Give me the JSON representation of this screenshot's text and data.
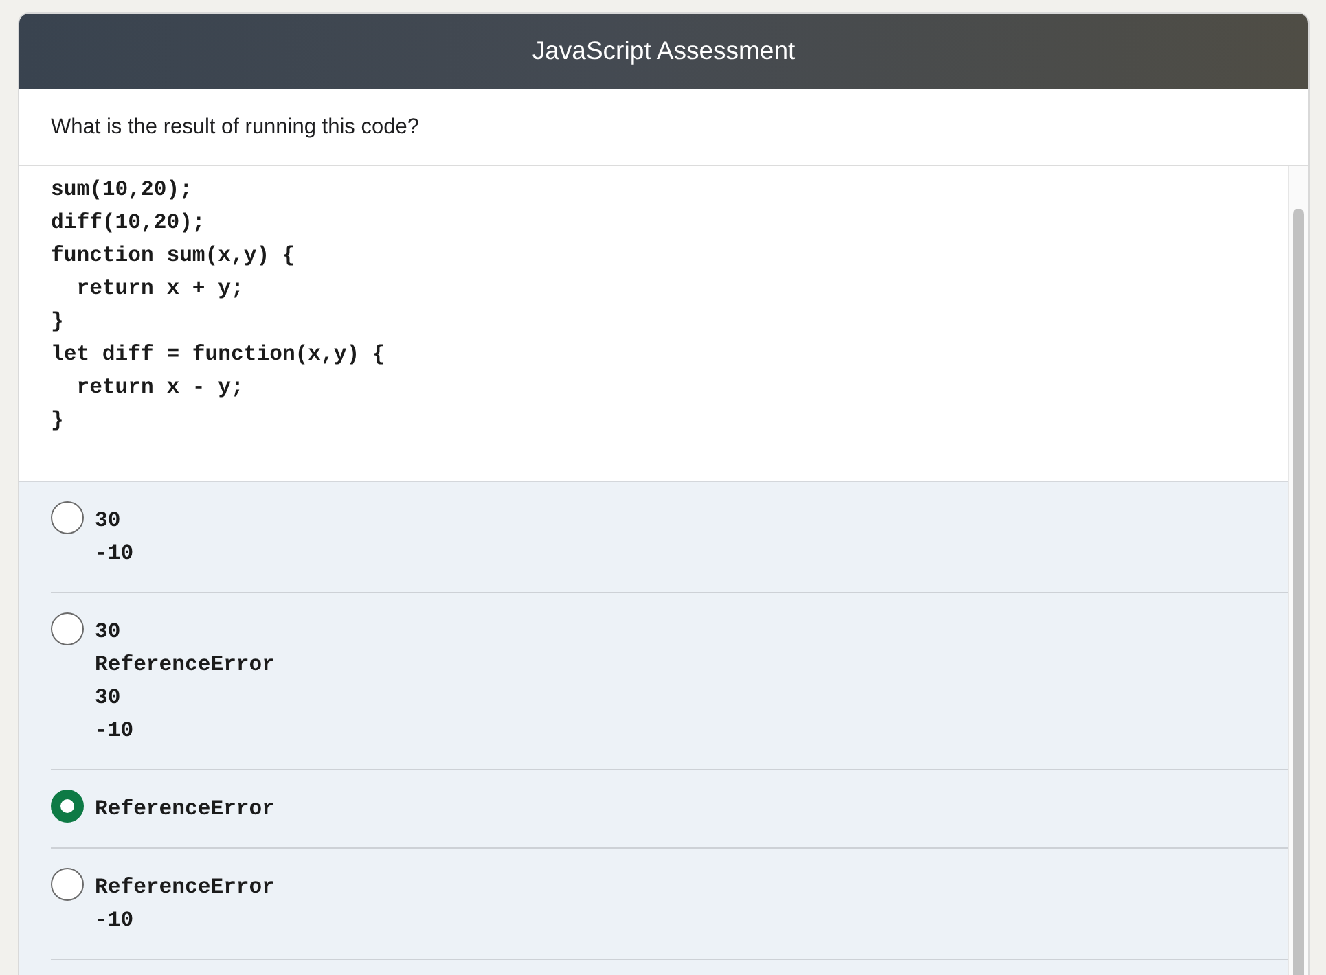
{
  "header": {
    "title": "JavaScript Assessment"
  },
  "question": {
    "prompt": "What is the result of running this code?",
    "code_lines": [
      "sum(10,20);",
      "diff(10,20);",
      "function sum(x,y) {",
      "  return x + y;",
      "}",
      "let diff = function(x,y) {",
      "  return x - y;",
      "}"
    ]
  },
  "options": [
    {
      "lines": [
        "30",
        "-10"
      ],
      "selected": false
    },
    {
      "lines": [
        "30",
        "ReferenceError",
        "30",
        "-10"
      ],
      "selected": false
    },
    {
      "lines": [
        "ReferenceError"
      ],
      "selected": true
    },
    {
      "lines": [
        "ReferenceError",
        "-10"
      ],
      "selected": false
    }
  ]
}
